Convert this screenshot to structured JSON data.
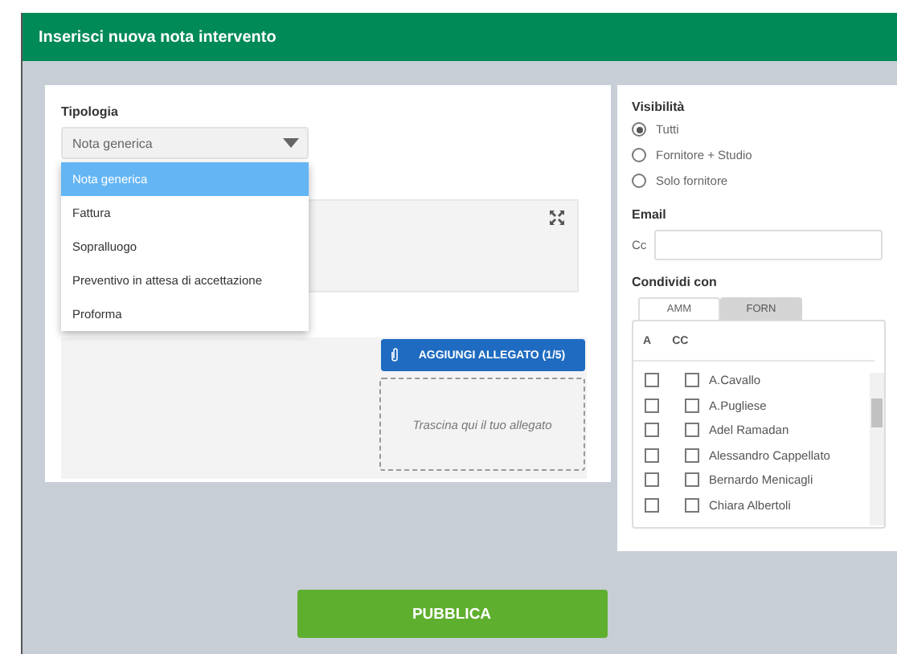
{
  "window": {
    "title": "Inserisci nuova nota intervento"
  },
  "tipologia": {
    "label": "Tipologia",
    "value": "Nota generica",
    "expanded": true,
    "options": [
      {
        "label": "Nota generica",
        "selected": true
      },
      {
        "label": "Fattura",
        "selected": false
      },
      {
        "label": "Sopralluogo",
        "selected": false
      },
      {
        "label": "Preventivo in attesa di accettazione",
        "selected": false
      },
      {
        "label": "Proforma",
        "selected": false
      }
    ]
  },
  "attachments": {
    "button": "AGGIUNGI ALLEGATO (1/5)",
    "dropzone": "Trascina qui il tuo allegato"
  },
  "visibility": {
    "label": "Visibilità",
    "options": [
      {
        "label": "Tutti",
        "selected": true
      },
      {
        "label": "Fornitore + Studio",
        "selected": false
      },
      {
        "label": "Solo fornitore",
        "selected": false
      }
    ]
  },
  "email": {
    "label": "Email",
    "cc_label": "Cc"
  },
  "share": {
    "label": "Condividi con",
    "tabs": [
      {
        "label": "AMM",
        "selected": true
      },
      {
        "label": "FORN",
        "selected": false
      }
    ],
    "columns": [
      "A",
      "CC"
    ],
    "rows": [
      {
        "name": "A.Cavallo",
        "a": false,
        "cc": false
      },
      {
        "name": "A.Pugliese",
        "a": false,
        "cc": false
      },
      {
        "name": "Adel Ramadan",
        "a": false,
        "cc": false
      },
      {
        "name": "Alessandro Cappellato",
        "a": false,
        "cc": false
      },
      {
        "name": "Bernardo Menicagli",
        "a": false,
        "cc": false
      },
      {
        "name": "Chiara Albertoli",
        "a": false,
        "cc": false
      }
    ]
  },
  "publish_button": "PUBBLICA"
}
